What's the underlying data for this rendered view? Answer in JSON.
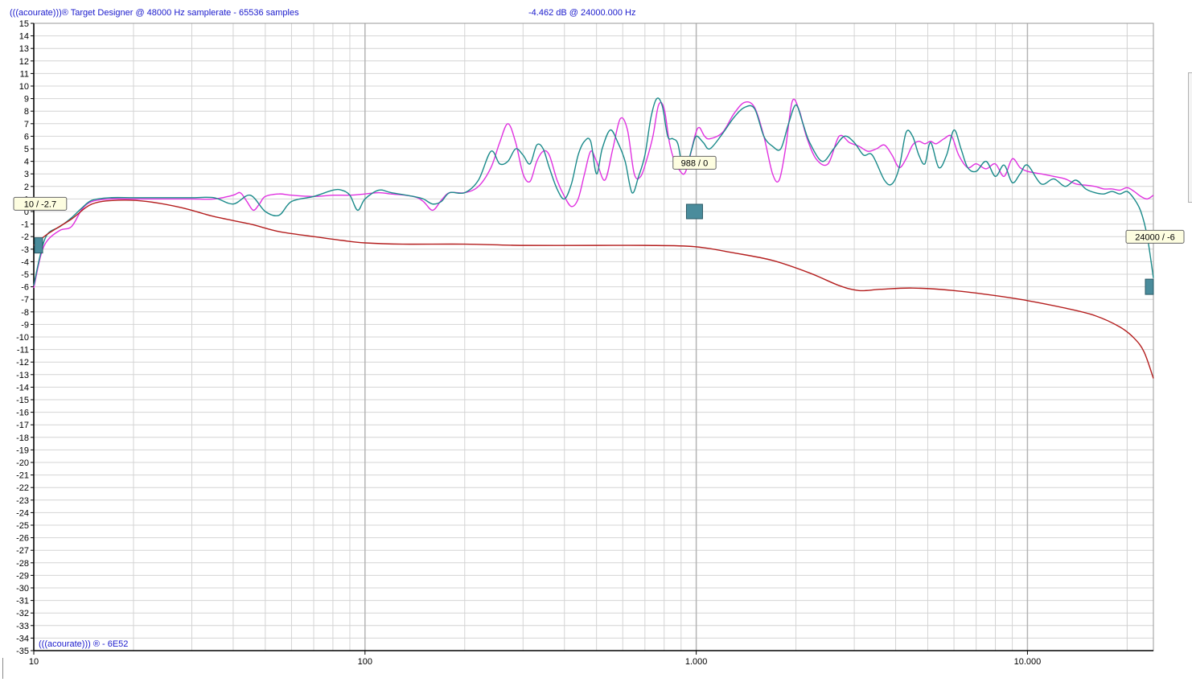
{
  "header": {
    "app_title": "(((acourate)))® Target Designer @ 48000 Hz samplerate - 65536 samples",
    "cursor_readout": "-4.462 dB @ 24000.000 Hz"
  },
  "footer": {
    "brand": "(((acourate))) ® - 6E52"
  },
  "colors": {
    "grid_minor": "#d4d4d4",
    "grid_decade": "#b4b4b4",
    "curve_magenta": "#e032e0",
    "curve_teal": "#1a8a8a",
    "curve_target": "#b41e1e",
    "marker_fill": "#4a8c9c",
    "axis": "#000000"
  },
  "markers": [
    {
      "name": "marker-low",
      "freq": 10,
      "db": -2.7,
      "label": "10 / -2.7"
    },
    {
      "name": "marker-mid",
      "freq": 988,
      "db": 0,
      "label": "988 / 0"
    },
    {
      "name": "marker-high",
      "freq": 24000,
      "db": -6,
      "label": "24000 / -6"
    }
  ],
  "chart_data": {
    "type": "line",
    "x_scale": "log",
    "xlim": [
      10,
      24000
    ],
    "ylim": [
      -35,
      15
    ],
    "grid": true,
    "x_ticks": [
      {
        "value": 10,
        "label": "10"
      },
      {
        "value": 100,
        "label": "100"
      },
      {
        "value": 1000,
        "label": "1.000"
      },
      {
        "value": 10000,
        "label": "10.000"
      }
    ],
    "y_ticks": [
      15,
      14,
      13,
      12,
      11,
      10,
      9,
      8,
      7,
      6,
      5,
      4,
      3,
      2,
      1,
      0,
      -1,
      -2,
      -3,
      -4,
      -5,
      -6,
      -7,
      -8,
      -9,
      -10,
      -11,
      -12,
      -13,
      -14,
      -15,
      -16,
      -17,
      -18,
      -19,
      -20,
      -21,
      -22,
      -23,
      -24,
      -25,
      -26,
      -27,
      -28,
      -29,
      -30,
      -31,
      -32,
      -33,
      -34,
      -35
    ],
    "series": [
      {
        "color": "#e032e0",
        "points": [
          [
            10,
            -6.1
          ],
          [
            10.5,
            -3.5
          ],
          [
            11,
            -2.3
          ],
          [
            12,
            -1.5
          ],
          [
            13,
            -1.2
          ],
          [
            14,
            0.2
          ],
          [
            15,
            0.8
          ],
          [
            17,
            1.0
          ],
          [
            20,
            1.0
          ],
          [
            25,
            1.0
          ],
          [
            30,
            1.0
          ],
          [
            35,
            1.0
          ],
          [
            40,
            1.3
          ],
          [
            42,
            1.5
          ],
          [
            44,
            0.8
          ],
          [
            46,
            0.1
          ],
          [
            48,
            0.6
          ],
          [
            50,
            1.2
          ],
          [
            55,
            1.4
          ],
          [
            60,
            1.3
          ],
          [
            70,
            1.2
          ],
          [
            80,
            1.3
          ],
          [
            90,
            1.3
          ],
          [
            100,
            1.4
          ],
          [
            110,
            1.5
          ],
          [
            120,
            1.4
          ],
          [
            140,
            1.2
          ],
          [
            150,
            0.8
          ],
          [
            160,
            0.1
          ],
          [
            170,
            0.9
          ],
          [
            180,
            1.5
          ],
          [
            200,
            1.5
          ],
          [
            220,
            2.0
          ],
          [
            240,
            3.5
          ],
          [
            255,
            5.5
          ],
          [
            270,
            7.0
          ],
          [
            285,
            5.5
          ],
          [
            300,
            3.0
          ],
          [
            315,
            2.4
          ],
          [
            330,
            4.0
          ],
          [
            345,
            4.8
          ],
          [
            360,
            4.5
          ],
          [
            380,
            2.5
          ],
          [
            400,
            1.2
          ],
          [
            420,
            0.4
          ],
          [
            440,
            1.0
          ],
          [
            460,
            3.0
          ],
          [
            480,
            4.8
          ],
          [
            500,
            4.0
          ],
          [
            530,
            2.5
          ],
          [
            560,
            5.0
          ],
          [
            590,
            7.4
          ],
          [
            620,
            6.5
          ],
          [
            650,
            3.0
          ],
          [
            680,
            2.8
          ],
          [
            710,
            4.2
          ],
          [
            740,
            6.0
          ],
          [
            770,
            8.5
          ],
          [
            800,
            8.2
          ],
          [
            830,
            5.5
          ],
          [
            860,
            4.0
          ],
          [
            890,
            3.3
          ],
          [
            920,
            3.0
          ],
          [
            950,
            4.0
          ],
          [
            990,
            6.0
          ],
          [
            1020,
            6.7
          ],
          [
            1060,
            6.0
          ],
          [
            1100,
            5.8
          ],
          [
            1200,
            6.3
          ],
          [
            1300,
            7.8
          ],
          [
            1400,
            8.7
          ],
          [
            1500,
            8.3
          ],
          [
            1600,
            6.0
          ],
          [
            1700,
            3.0
          ],
          [
            1780,
            2.5
          ],
          [
            1860,
            5.0
          ],
          [
            1950,
            8.8
          ],
          [
            2050,
            8.0
          ],
          [
            2150,
            6.0
          ],
          [
            2300,
            4.2
          ],
          [
            2500,
            3.8
          ],
          [
            2700,
            6.0
          ],
          [
            2900,
            5.5
          ],
          [
            3100,
            5.2
          ],
          [
            3300,
            4.8
          ],
          [
            3500,
            5.0
          ],
          [
            3700,
            5.3
          ],
          [
            3900,
            4.5
          ],
          [
            4100,
            3.5
          ],
          [
            4300,
            4.2
          ],
          [
            4500,
            5.3
          ],
          [
            4700,
            5.6
          ],
          [
            4900,
            5.4
          ],
          [
            5100,
            5.6
          ],
          [
            5300,
            5.4
          ],
          [
            5600,
            5.8
          ],
          [
            5900,
            6.0
          ],
          [
            6200,
            4.5
          ],
          [
            6600,
            3.5
          ],
          [
            7000,
            3.8
          ],
          [
            7500,
            3.4
          ],
          [
            8000,
            3.8
          ],
          [
            8500,
            2.8
          ],
          [
            9000,
            4.2
          ],
          [
            9500,
            3.5
          ],
          [
            10000,
            3.2
          ],
          [
            11000,
            3.0
          ],
          [
            12000,
            2.8
          ],
          [
            13000,
            2.6
          ],
          [
            14000,
            2.2
          ],
          [
            15000,
            2.1
          ],
          [
            16000,
            2.0
          ],
          [
            17000,
            1.8
          ],
          [
            18000,
            1.8
          ],
          [
            19000,
            1.7
          ],
          [
            20000,
            1.9
          ],
          [
            21000,
            1.6
          ],
          [
            22000,
            1.2
          ],
          [
            23000,
            1.0
          ],
          [
            24000,
            1.3
          ]
        ]
      },
      {
        "color": "#1a8a8a",
        "points": [
          [
            10,
            -5.9
          ],
          [
            10.5,
            -3.3
          ],
          [
            11,
            -1.8
          ],
          [
            12,
            -1.2
          ],
          [
            13,
            -0.5
          ],
          [
            14,
            0.3
          ],
          [
            15,
            0.9
          ],
          [
            17,
            1.1
          ],
          [
            20,
            1.1
          ],
          [
            25,
            1.1
          ],
          [
            30,
            1.1
          ],
          [
            35,
            1.1
          ],
          [
            40,
            0.6
          ],
          [
            45,
            1.3
          ],
          [
            50,
            0.0
          ],
          [
            55,
            -0.3
          ],
          [
            60,
            0.8
          ],
          [
            70,
            1.2
          ],
          [
            80,
            1.7
          ],
          [
            85,
            1.7
          ],
          [
            90,
            1.3
          ],
          [
            95,
            0.1
          ],
          [
            100,
            1.0
          ],
          [
            110,
            1.7
          ],
          [
            120,
            1.5
          ],
          [
            140,
            1.2
          ],
          [
            150,
            1.0
          ],
          [
            160,
            0.6
          ],
          [
            170,
            0.8
          ],
          [
            180,
            1.5
          ],
          [
            200,
            1.5
          ],
          [
            220,
            2.5
          ],
          [
            240,
            4.8
          ],
          [
            255,
            3.8
          ],
          [
            270,
            4.0
          ],
          [
            285,
            5.0
          ],
          [
            300,
            4.5
          ],
          [
            315,
            3.8
          ],
          [
            330,
            5.3
          ],
          [
            345,
            5.0
          ],
          [
            360,
            3.5
          ],
          [
            380,
            1.8
          ],
          [
            400,
            1.0
          ],
          [
            420,
            2.2
          ],
          [
            440,
            4.5
          ],
          [
            460,
            5.6
          ],
          [
            480,
            5.6
          ],
          [
            500,
            3.0
          ],
          [
            520,
            5.0
          ],
          [
            550,
            6.5
          ],
          [
            580,
            5.5
          ],
          [
            610,
            4.0
          ],
          [
            640,
            1.5
          ],
          [
            670,
            2.8
          ],
          [
            700,
            4.5
          ],
          [
            730,
            7.5
          ],
          [
            760,
            9.0
          ],
          [
            790,
            8.4
          ],
          [
            820,
            6.0
          ],
          [
            850,
            5.8
          ],
          [
            880,
            5.4
          ],
          [
            910,
            3.5
          ],
          [
            940,
            3.8
          ],
          [
            970,
            5.0
          ],
          [
            1000,
            6.0
          ],
          [
            1050,
            5.5
          ],
          [
            1100,
            5.0
          ],
          [
            1200,
            6.2
          ],
          [
            1300,
            7.5
          ],
          [
            1400,
            8.3
          ],
          [
            1500,
            8.2
          ],
          [
            1600,
            6.0
          ],
          [
            1700,
            5.2
          ],
          [
            1800,
            5.0
          ],
          [
            1900,
            7.0
          ],
          [
            2000,
            8.5
          ],
          [
            2100,
            7.0
          ],
          [
            2200,
            5.5
          ],
          [
            2400,
            4.0
          ],
          [
            2600,
            5.0
          ],
          [
            2800,
            6.0
          ],
          [
            3000,
            5.5
          ],
          [
            3200,
            4.5
          ],
          [
            3400,
            4.5
          ],
          [
            3700,
            2.5
          ],
          [
            3900,
            2.2
          ],
          [
            4100,
            3.5
          ],
          [
            4300,
            6.3
          ],
          [
            4500,
            6.0
          ],
          [
            4700,
            4.5
          ],
          [
            4900,
            3.8
          ],
          [
            5100,
            5.5
          ],
          [
            5400,
            3.5
          ],
          [
            5700,
            4.5
          ],
          [
            6000,
            6.5
          ],
          [
            6300,
            5.0
          ],
          [
            6600,
            3.5
          ],
          [
            7000,
            3.2
          ],
          [
            7500,
            4.0
          ],
          [
            8000,
            2.8
          ],
          [
            8500,
            3.7
          ],
          [
            9000,
            2.3
          ],
          [
            9500,
            3.0
          ],
          [
            10000,
            3.7
          ],
          [
            11000,
            2.2
          ],
          [
            12000,
            2.6
          ],
          [
            13000,
            2.0
          ],
          [
            14000,
            2.5
          ],
          [
            15000,
            1.8
          ],
          [
            16000,
            1.5
          ],
          [
            17000,
            1.4
          ],
          [
            18000,
            1.6
          ],
          [
            19000,
            1.4
          ],
          [
            20000,
            1.6
          ],
          [
            21000,
            1.0
          ],
          [
            22000,
            0.0
          ],
          [
            23000,
            -2.0
          ],
          [
            24000,
            -5.3
          ]
        ]
      },
      {
        "color": "#b41e1e",
        "points": [
          [
            10,
            -2.7
          ],
          [
            11,
            -1.8
          ],
          [
            13,
            -0.6
          ],
          [
            15,
            0.6
          ],
          [
            18,
            0.9
          ],
          [
            22,
            0.8
          ],
          [
            28,
            0.3
          ],
          [
            35,
            -0.4
          ],
          [
            45,
            -1.0
          ],
          [
            55,
            -1.6
          ],
          [
            70,
            -2.0
          ],
          [
            85,
            -2.3
          ],
          [
            100,
            -2.5
          ],
          [
            130,
            -2.6
          ],
          [
            200,
            -2.6
          ],
          [
            300,
            -2.7
          ],
          [
            500,
            -2.7
          ],
          [
            700,
            -2.7
          ],
          [
            988,
            -2.8
          ],
          [
            1300,
            -3.3
          ],
          [
            1700,
            -3.9
          ],
          [
            2200,
            -4.9
          ],
          [
            2700,
            -5.9
          ],
          [
            3100,
            -6.3
          ],
          [
            3600,
            -6.2
          ],
          [
            4500,
            -6.1
          ],
          [
            6000,
            -6.3
          ],
          [
            8000,
            -6.7
          ],
          [
            10000,
            -7.1
          ],
          [
            13000,
            -7.7
          ],
          [
            16000,
            -8.3
          ],
          [
            19000,
            -9.2
          ],
          [
            21000,
            -10.1
          ],
          [
            22500,
            -11.2
          ],
          [
            24000,
            -13.3
          ]
        ]
      }
    ]
  }
}
